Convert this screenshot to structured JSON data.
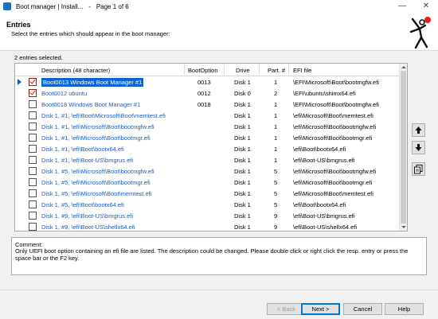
{
  "window": {
    "title_app": "Boot manager | Install...",
    "title_sep": "-",
    "title_page": "Page 1 of 6",
    "minimize_glyph": "—",
    "close_glyph": "✕"
  },
  "header": {
    "title": "Entries",
    "subtitle": "Select the entries which should appear in the boot manager:",
    "logo_icon": "stick-figure-logo-icon"
  },
  "selection_count": "2 entries selected.",
  "table": {
    "columns": [
      "Description (48 character)",
      "BootOption",
      "Drive",
      "Part. #",
      "EFI file"
    ],
    "rows": [
      {
        "checked": true,
        "current": true,
        "desc": "Boot0013 Windows Boot Manager #1",
        "boot": "0013",
        "drive": "Disk 1",
        "part": "1",
        "efi": "\\EFI\\Microsoft\\Boot\\bootmgfw.efi"
      },
      {
        "checked": true,
        "current": false,
        "desc": "Boot0012 ubuntu",
        "boot": "0012",
        "drive": "Disk 0",
        "part": "2",
        "efi": "\\EFI\\ubuntu\\shimx64.efi"
      },
      {
        "checked": false,
        "current": false,
        "desc": "Boot0018 Windows Boot Manager #1",
        "boot": "0018",
        "drive": "Disk 1",
        "part": "1",
        "efi": "\\EFI\\Microsoft\\Boot\\bootmgfw.efi"
      },
      {
        "checked": false,
        "current": false,
        "desc": "Disk 1, #1, \\efi\\Boot\\Microsoft\\Boot\\memtest.efi",
        "boot": "",
        "drive": "Disk 1",
        "part": "1",
        "efi": "\\efi\\Microsoft\\Boot\\memtest.efi"
      },
      {
        "checked": false,
        "current": false,
        "desc": "Disk 1, #1, \\efi\\Microsoft\\Boot\\bootmgfw.efi",
        "boot": "",
        "drive": "Disk 1",
        "part": "1",
        "efi": "\\efi\\Microsoft\\Boot\\bootmgfw.efi"
      },
      {
        "checked": false,
        "current": false,
        "desc": "Disk 1, #1, \\efi\\Microsoft\\Boot\\bootmgr.efi",
        "boot": "",
        "drive": "Disk 1",
        "part": "1",
        "efi": "\\efi\\Microsoft\\Boot\\bootmgr.efi"
      },
      {
        "checked": false,
        "current": false,
        "desc": "Disk 1, #1, \\efi\\Boot\\bootx64.efi",
        "boot": "",
        "drive": "Disk 1",
        "part": "1",
        "efi": "\\efi\\Boot\\bootx64.efi"
      },
      {
        "checked": false,
        "current": false,
        "desc": "Disk 1, #1, \\efi\\Boot-US\\bmgrus.efi",
        "boot": "",
        "drive": "Disk 1",
        "part": "1",
        "efi": "\\efi\\Boot-US\\bmgrus.efi"
      },
      {
        "checked": false,
        "current": false,
        "desc": "Disk 1, #5, \\efi\\Microsoft\\Boot\\bootmgfw.efi",
        "boot": "",
        "drive": "Disk 1",
        "part": "5",
        "efi": "\\efi\\Microsoft\\Boot\\bootmgfw.efi"
      },
      {
        "checked": false,
        "current": false,
        "desc": "Disk 1, #5, \\efi\\Microsoft\\Boot\\bootmgr.efi",
        "boot": "",
        "drive": "Disk 1",
        "part": "5",
        "efi": "\\efi\\Microsoft\\Boot\\bootmgr.efi"
      },
      {
        "checked": false,
        "current": false,
        "desc": "Disk 1, #5, \\efi\\Microsoft\\Boot\\memtest.efi",
        "boot": "",
        "drive": "Disk 1",
        "part": "5",
        "efi": "\\efi\\Microsoft\\Boot\\memtest.efi"
      },
      {
        "checked": false,
        "current": false,
        "desc": "Disk 1, #5, \\efi\\Boot\\bootx64.efi",
        "boot": "",
        "drive": "Disk 1",
        "part": "5",
        "efi": "\\efi\\Boot\\bootx64.efi"
      },
      {
        "checked": false,
        "current": false,
        "desc": "Disk 1, #9, \\efi\\Boot-US\\bmgrus.efi",
        "boot": "",
        "drive": "Disk 1",
        "part": "9",
        "efi": "\\efi\\Boot-US\\bmgrus.efi"
      },
      {
        "checked": false,
        "current": false,
        "desc": "Disk 1, #9, \\efi\\Boot-US\\shellx64.efi",
        "boot": "",
        "drive": "Disk 1",
        "part": "9",
        "efi": "\\efi\\Boot-US\\shellx64.efi"
      }
    ]
  },
  "side_buttons": [
    {
      "name": "move-up-button",
      "icon": "arrow-up-icon"
    },
    {
      "name": "move-down-button",
      "icon": "arrow-down-icon"
    },
    {
      "name": "copy-entry-button",
      "icon": "copy-icon"
    }
  ],
  "comment": {
    "label": "Comment:",
    "text": "Only UEFI boot option containing an efi file are listed. The description could be changed. Please double click or right click the resp. entry or press the space bar or the F2 key."
  },
  "buttons": {
    "back": "< Back",
    "next": "Next >",
    "cancel": "Cancel",
    "help": "Help"
  }
}
